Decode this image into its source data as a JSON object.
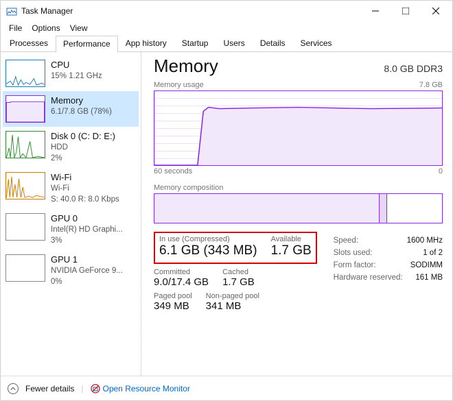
{
  "window": {
    "title": "Task Manager"
  },
  "menu": [
    "File",
    "Options",
    "View"
  ],
  "tabs": [
    "Processes",
    "Performance",
    "App history",
    "Startup",
    "Users",
    "Details",
    "Services"
  ],
  "activeTab": 1,
  "sidebar": [
    {
      "name": "CPU",
      "detail1": "15% 1.21 GHz",
      "detail2": ""
    },
    {
      "name": "Memory",
      "detail1": "6.1/7.8 GB (78%)",
      "detail2": ""
    },
    {
      "name": "Disk 0 (C: D: E:)",
      "detail1": "HDD",
      "detail2": "2%"
    },
    {
      "name": "Wi-Fi",
      "detail1": "Wi-Fi",
      "detail2": "S: 40.0 R: 8.0 Kbps"
    },
    {
      "name": "GPU 0",
      "detail1": "Intel(R) HD Graphi...",
      "detail2": "3%"
    },
    {
      "name": "GPU 1",
      "detail1": "NVIDIA GeForce 9...",
      "detail2": "0%"
    }
  ],
  "selectedSidebar": 1,
  "header": {
    "title": "Memory",
    "sub": "8.0 GB DDR3"
  },
  "chart1": {
    "label": "Memory usage",
    "max": "7.8 GB",
    "xLeft": "60 seconds",
    "xRight": "0"
  },
  "chart2": {
    "label": "Memory composition"
  },
  "stats": {
    "inUseLabel": "In use (Compressed)",
    "inUseValue": "6.1 GB (343 MB)",
    "availableLabel": "Available",
    "availableValue": "1.7 GB",
    "committedLabel": "Committed",
    "committedValue": "9.0/17.4 GB",
    "cachedLabel": "Cached",
    "cachedValue": "1.7 GB",
    "pagedLabel": "Paged pool",
    "pagedValue": "349 MB",
    "nonpagedLabel": "Non-paged pool",
    "nonpagedValue": "341 MB"
  },
  "kv": {
    "speed": {
      "k": "Speed:",
      "v": "1600 MHz"
    },
    "slots": {
      "k": "Slots used:",
      "v": "1 of 2"
    },
    "form": {
      "k": "Form factor:",
      "v": "SODIMM"
    },
    "hw": {
      "k": "Hardware reserved:",
      "v": "161 MB"
    }
  },
  "footer": {
    "fewer": "Fewer details",
    "orm": "Open Resource Monitor"
  },
  "chart_data": {
    "type": "area",
    "title": "Memory usage",
    "ylabel": "GB",
    "ylim": [
      0,
      7.8
    ],
    "x": [
      60,
      55,
      50,
      49,
      48,
      45,
      40,
      30,
      20,
      10,
      0
    ],
    "values": [
      0.0,
      0.0,
      0.0,
      5.2,
      6.0,
      6.05,
      6.1,
      6.1,
      6.05,
      6.1,
      6.1
    ],
    "composition": {
      "in_use_pct": 78,
      "modified_pct": 3,
      "standby_free_pct": 19
    }
  }
}
